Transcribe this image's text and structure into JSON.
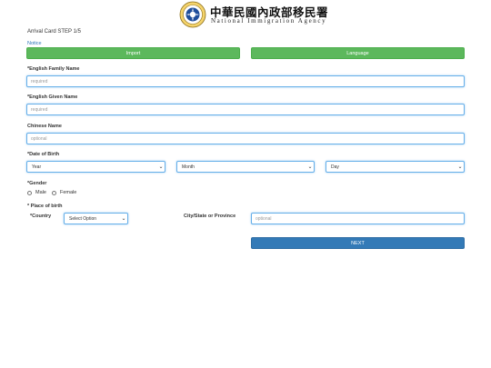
{
  "header": {
    "agency_name_zh": "中華民國內政部移民署",
    "agency_name_en": "National Immigration Agency",
    "emblem_icon": "immigration-agency-emblem"
  },
  "form": {
    "step_title": "Arrival Card STEP 1/5",
    "notice_link": "Notice",
    "import_button": "Import",
    "language_button": "Language",
    "family_name": {
      "label": "*English Family Name",
      "placeholder": "required"
    },
    "given_name": {
      "label": "*English Given Name",
      "placeholder": "required"
    },
    "chinese_name": {
      "label": "Chinese Name",
      "placeholder": "optional"
    },
    "date_of_birth": {
      "label": "*Date of Birth",
      "year": "Year",
      "month": "Month",
      "day": "Day"
    },
    "gender": {
      "label": "*Gender",
      "options": [
        "Male",
        "Female"
      ]
    },
    "place_of_birth": {
      "label": "* Place of birth",
      "country_label": "*Country",
      "country_value": "Select Option",
      "city_label": "City/State or Province",
      "city_placeholder": "optional"
    },
    "next_button": "NEXT"
  },
  "colors": {
    "green_button": "#5cb85c",
    "blue_button": "#337ab7",
    "input_focus_border": "#66afe9",
    "link": "#2a74b8"
  }
}
